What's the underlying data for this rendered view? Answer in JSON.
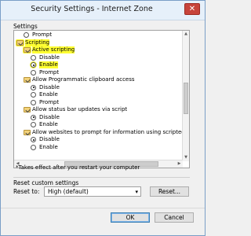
{
  "window": {
    "title": "Security Settings - Internet Zone",
    "close_glyph": "✕"
  },
  "settings_label": "Settings",
  "tree": [
    {
      "kind": "radio",
      "indent": 1,
      "label": "Prompt",
      "checked": false,
      "highlight": false
    },
    {
      "kind": "folder",
      "indent": 0,
      "label": "Scripting",
      "highlight": true
    },
    {
      "kind": "folder",
      "indent": 1,
      "label": "Active scripting",
      "highlight": true
    },
    {
      "kind": "radio",
      "indent": 2,
      "label": "Disable",
      "checked": false,
      "highlight": false
    },
    {
      "kind": "radio",
      "indent": 2,
      "label": "Enable",
      "checked": true,
      "highlight": true
    },
    {
      "kind": "radio",
      "indent": 2,
      "label": "Prompt",
      "checked": false,
      "highlight": false
    },
    {
      "kind": "folder",
      "indent": 1,
      "label": "Allow Programmatic clipboard access",
      "highlight": false
    },
    {
      "kind": "radio",
      "indent": 2,
      "label": "Disable",
      "checked": true,
      "highlight": false
    },
    {
      "kind": "radio",
      "indent": 2,
      "label": "Enable",
      "checked": false,
      "highlight": false
    },
    {
      "kind": "radio",
      "indent": 2,
      "label": "Prompt",
      "checked": false,
      "highlight": false
    },
    {
      "kind": "folder",
      "indent": 1,
      "label": "Allow status bar updates via script",
      "highlight": false
    },
    {
      "kind": "radio",
      "indent": 2,
      "label": "Disable",
      "checked": true,
      "highlight": false
    },
    {
      "kind": "radio",
      "indent": 2,
      "label": "Enable",
      "checked": false,
      "highlight": false
    },
    {
      "kind": "folder",
      "indent": 1,
      "label": "Allow websites to prompt for information using scripted windo",
      "highlight": false
    },
    {
      "kind": "radio",
      "indent": 2,
      "label": "Disable",
      "checked": true,
      "highlight": false
    },
    {
      "kind": "radio",
      "indent": 2,
      "label": "Enable",
      "checked": false,
      "highlight": false
    }
  ],
  "note": "*Takes effect after you restart your computer",
  "reset": {
    "group_title": "Reset custom settings",
    "reset_to_label": "Reset to:",
    "selected": "High (default)",
    "reset_button": "Reset..."
  },
  "buttons": {
    "ok": "OK",
    "cancel": "Cancel"
  },
  "colors": {
    "highlight": "#ffff33",
    "title_bg": "#e6f0fa",
    "close_bg": "#c7443b"
  }
}
